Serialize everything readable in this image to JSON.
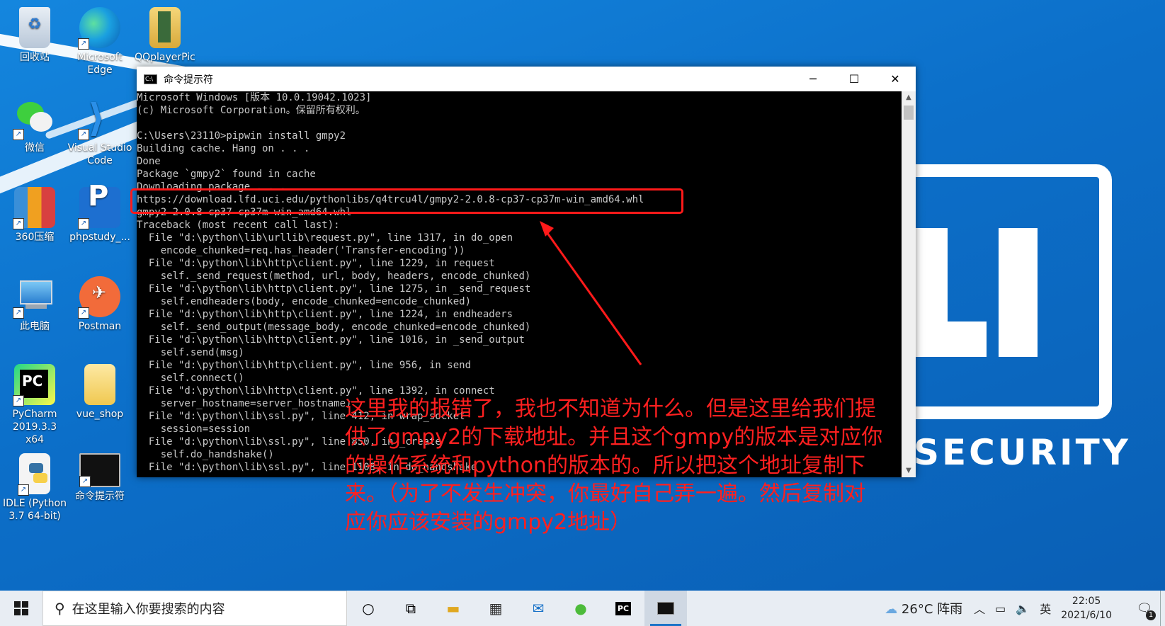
{
  "desktop": {
    "icons": [
      {
        "label": "回收站"
      },
      {
        "label": "Microsoft Edge"
      },
      {
        "label": "QQplayerPic"
      },
      {
        "label": "微信"
      },
      {
        "label": "Visual Studio Code"
      },
      {
        "label": "360压缩"
      },
      {
        "label": "phpstudy_..."
      },
      {
        "label": "此电脑"
      },
      {
        "label": "Postman"
      },
      {
        "label": "PyCharm 2019.3.3 x64"
      },
      {
        "label": "vue_shop"
      },
      {
        "label": "IDLE (Python 3.7 64-bit)"
      },
      {
        "label": "命令提示符"
      }
    ],
    "wallpaper_text": "SECURITY"
  },
  "window": {
    "title": "命令提示符",
    "minimize": "─",
    "maximize": "☐",
    "close": "✕",
    "console_lines": [
      "Microsoft Windows [版本 10.0.19042.1023]",
      "(c) Microsoft Corporation。保留所有权利。",
      "",
      "C:\\Users\\23110>pipwin install gmpy2",
      "Building cache. Hang on . . .",
      "Done",
      "Package `gmpy2` found in cache",
      "Downloading package . . .",
      "https://download.lfd.uci.edu/pythonlibs/q4trcu4l/gmpy2-2.0.8-cp37-cp37m-win_amd64.whl",
      "gmpy2-2.0.8-cp37-cp37m-win_amd64.whl",
      "Traceback (most recent call last):",
      "  File \"d:\\python\\lib\\urllib\\request.py\", line 1317, in do_open",
      "    encode_chunked=req.has_header('Transfer-encoding'))",
      "  File \"d:\\python\\lib\\http\\client.py\", line 1229, in request",
      "    self._send_request(method, url, body, headers, encode_chunked)",
      "  File \"d:\\python\\lib\\http\\client.py\", line 1275, in _send_request",
      "    self.endheaders(body, encode_chunked=encode_chunked)",
      "  File \"d:\\python\\lib\\http\\client.py\", line 1224, in endheaders",
      "    self._send_output(message_body, encode_chunked=encode_chunked)",
      "  File \"d:\\python\\lib\\http\\client.py\", line 1016, in _send_output",
      "    self.send(msg)",
      "  File \"d:\\python\\lib\\http\\client.py\", line 956, in send",
      "    self.connect()",
      "  File \"d:\\python\\lib\\http\\client.py\", line 1392, in connect",
      "    server_hostname=server_hostname)",
      "  File \"d:\\python\\lib\\ssl.py\", line 412, in wrap_socket",
      "    session=session",
      "  File \"d:\\python\\lib\\ssl.py\", line 850, in _create",
      "    self.do_handshake()",
      "  File \"d:\\python\\lib\\ssl.py\", line 1108, in do_handshake"
    ]
  },
  "annotation": {
    "note": "这里我的报错了，我也不知道为什么。但是这里给我们提供了gmpy2的下载地址。并且这个gmpy的版本是对应你的操作系统和python的版本的。所以把这个地址复制下来。（为了不发生冲突，你最好自己弄一遍。然后复制对应你应该安装的gmpy2地址）",
    "color": "#ff2020"
  },
  "taskbar": {
    "search_placeholder": "在这里输入你要搜索的内容",
    "weather": "26°C 阵雨",
    "ime": "英",
    "time": "22:05",
    "date": "2021/6/10",
    "notification_count": "1"
  }
}
